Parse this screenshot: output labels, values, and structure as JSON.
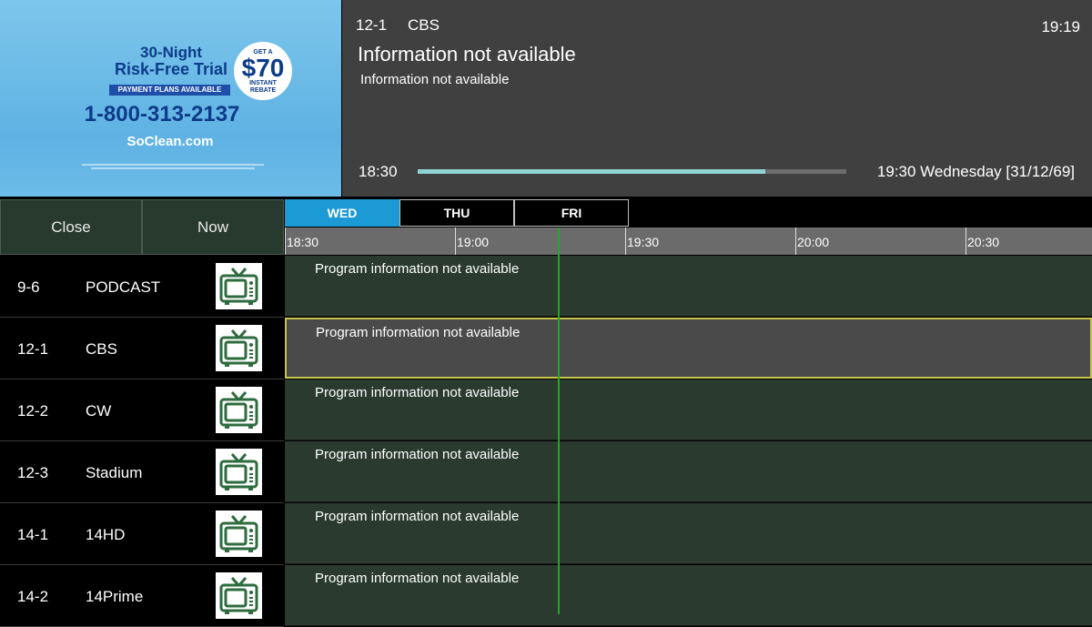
{
  "preview": {
    "ad_line1": "30-Night",
    "ad_line2": "Risk-Free Trial",
    "ad_badge_top": "GET A",
    "ad_badge_amount": "$70",
    "ad_badge_bottom1": "INSTANT",
    "ad_badge_bottom2": "REBATE",
    "ad_plans": "PAYMENT PLANS AVAILABLE",
    "ad_phone": "1-800-313-2137",
    "ad_site": "SoClean.com"
  },
  "info": {
    "channel_number": "12-1",
    "channel_name": "CBS",
    "clock": "19:19",
    "program_title": "Information not available",
    "program_description": "Information not available",
    "start_time": "18:30",
    "end_time": "19:30 Wednesday  [31/12/69]",
    "progress_percent": 81
  },
  "controls": {
    "close_label": "Close",
    "now_label": "Now"
  },
  "days": [
    "WED",
    "THU",
    "FRI"
  ],
  "active_day": "WED",
  "timeline": [
    "18:30",
    "19:00",
    "19:30",
    "20:00",
    "20:30"
  ],
  "channels": [
    {
      "number": "9-6",
      "name": "PODCAST",
      "program": "Program information not available",
      "selected": false
    },
    {
      "number": "12-1",
      "name": "CBS",
      "program": "Program information not available",
      "selected": true
    },
    {
      "number": "12-2",
      "name": "CW",
      "program": "Program information not available",
      "selected": false
    },
    {
      "number": "12-3",
      "name": "Stadium",
      "program": "Program information not available",
      "selected": false
    },
    {
      "number": "14-1",
      "name": "14HD",
      "program": "Program information not available",
      "selected": false
    },
    {
      "number": "14-2",
      "name": "14Prime",
      "program": "Program information not available",
      "selected": false
    }
  ],
  "icons": {
    "channel_logo": "tv-icon"
  },
  "colors": {
    "active_tab": "#1b9ad6",
    "now_line": "#1faa1f",
    "selected_border": "#c8c64a",
    "progress": "#8fd3d3"
  }
}
